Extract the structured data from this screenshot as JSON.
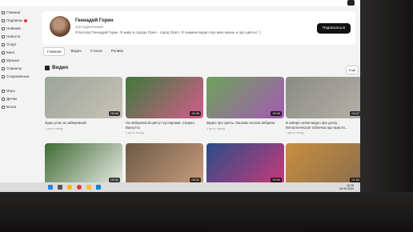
{
  "sidebar": {
    "items": [
      {
        "label": "Главная"
      },
      {
        "label": "Подписки"
      },
      {
        "label": "Новинки"
      },
      {
        "label": "Новости"
      },
      {
        "label": "Спорт"
      },
      {
        "label": "Кино"
      },
      {
        "label": "Музыка"
      },
      {
        "label": "Сериалы"
      },
      {
        "label": "Сохранённые"
      },
      {
        "label": "Игры"
      },
      {
        "label": "Детям"
      },
      {
        "label": "Блоги"
      }
    ]
  },
  "channel": {
    "name": "Геннадий Горин",
    "subscribers": "115 подписчиков",
    "description": "Я Блогер Геннадий Горин. Я живу в городе Орел - город Орёл. Я снимаю видео про мою жизнь и про цветы! ⓘ",
    "subscribe_label": "Подписаться"
  },
  "tabs": [
    {
      "label": "Главная",
      "active": true
    },
    {
      "label": "Видео",
      "active": false
    },
    {
      "label": "Статьи",
      "active": false
    },
    {
      "label": "Ролики",
      "active": false
    }
  ],
  "section": {
    "title": "Видео",
    "sort_label": "Ещё"
  },
  "videos": [
    {
      "title": "Одна утка на набережной",
      "age": "1 день назад",
      "duration": "00:40",
      "colors": [
        "#9aa39b",
        "#c9c3b6"
      ]
    },
    {
      "title": "На набережной цветут кустарники. Спирея Вангутта",
      "age": "1 день назад",
      "duration": "00:45",
      "colors": [
        "#3e7a3a",
        "#d45c8c"
      ]
    },
    {
      "title": "Видео про цветы. Мальва лесная Зебрина",
      "age": "1 день назад",
      "duration": "00:40",
      "colors": [
        "#6ea35a",
        "#a45ab5"
      ]
    },
    {
      "title": "В сквере сняли видео про доску. Металлическая табличка про Кристи...",
      "age": "1 день назад",
      "duration": "04:27",
      "colors": [
        "#8b8b86",
        "#b3b1a7"
      ]
    },
    {
      "title": "",
      "age": "",
      "duration": "00:31",
      "colors": [
        "#3f6b35",
        "#e8ebe4"
      ]
    },
    {
      "title": "",
      "age": "",
      "duration": "08:31",
      "colors": [
        "#6b5a44",
        "#c99c80"
      ]
    },
    {
      "title": "",
      "age": "",
      "duration": "00:53",
      "colors": [
        "#2a4c8a",
        "#c83a7a"
      ]
    },
    {
      "title": "",
      "age": "",
      "duration": "01:54",
      "colors": [
        "#c88f3d",
        "#8a6d4f"
      ]
    }
  ],
  "taskbar": {
    "time": "18:28",
    "date": "26.05.2024"
  }
}
